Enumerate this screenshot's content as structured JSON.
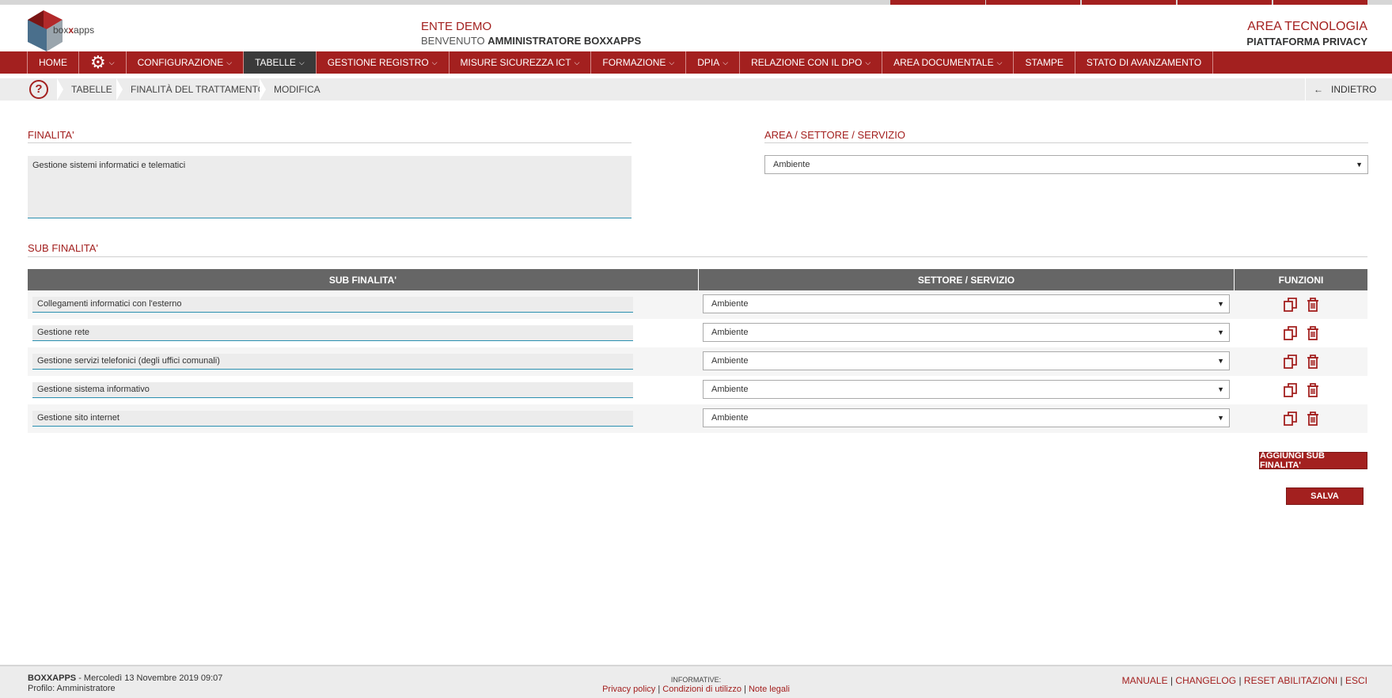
{
  "header": {
    "logo_text_pre": "box",
    "logo_text_bold": "x",
    "logo_text_post": "apps",
    "ente": "ENTE DEMO",
    "welcome_prefix": "BENVENUTO",
    "welcome_user": "AMMINISTRATORE BOXXAPPS",
    "area": "AREA TECNOLOGIA",
    "platform": "PIATTAFORMA PRIVACY"
  },
  "nav": {
    "items": [
      {
        "label": "HOME",
        "chevron": false
      },
      {
        "label": "",
        "chevron": true,
        "icon": "gear-icon"
      },
      {
        "label": "CONFIGURAZIONE",
        "chevron": true
      },
      {
        "label": "TABELLE",
        "chevron": true,
        "active": true
      },
      {
        "label": "GESTIONE REGISTRO",
        "chevron": true
      },
      {
        "label": "MISURE SICUREZZA ICT",
        "chevron": true
      },
      {
        "label": "FORMAZIONE",
        "chevron": true
      },
      {
        "label": "DPIA",
        "chevron": true
      },
      {
        "label": "RELAZIONE CON IL DPO",
        "chevron": true
      },
      {
        "label": "AREA DOCUMENTALE",
        "chevron": true
      },
      {
        "label": "STAMPE",
        "chevron": false
      },
      {
        "label": "STATO DI AVANZAMENTO",
        "chevron": false
      }
    ]
  },
  "breadcrumb": {
    "items": [
      "TABELLE",
      "FINALITÀ DEL TRATTAMENTO",
      "MODIFICA"
    ],
    "back_label": "INDIETRO"
  },
  "form": {
    "finalita_title": "FINALITA'",
    "finalita_value": "Gestione sistemi informatici e telematici",
    "area_title": "AREA / SETTORE / SERVIZIO",
    "area_value": "Ambiente",
    "sub_title": "SUB FINALITA'"
  },
  "table": {
    "headers": [
      "SUB FINALITA'",
      "SETTORE / SERVIZIO",
      "FUNZIONI"
    ],
    "rows": [
      {
        "sub": "Collegamenti informatici con l'esterno",
        "settore": "Ambiente"
      },
      {
        "sub": "Gestione rete",
        "settore": "Ambiente"
      },
      {
        "sub": "Gestione servizi telefonici (degli uffici comunali)",
        "settore": "Ambiente"
      },
      {
        "sub": "Gestione sistema informativo",
        "settore": "Ambiente"
      },
      {
        "sub": "Gestione sito internet",
        "settore": "Ambiente"
      }
    ]
  },
  "buttons": {
    "add_sub": "AGGIUNGI SUB FINALITA'",
    "save": "SALVA"
  },
  "footer": {
    "brand": "BOXXAPPS",
    "datetime": " - Mercoledì 13 Novembre 2019 09:07",
    "profile": "Profilo: Amministratore",
    "informative_label": "INFORMATIVE:",
    "links_center": [
      "Privacy policy",
      "Condizioni di utilizzo",
      "Note legali"
    ],
    "links_right": [
      "MANUALE",
      "CHANGELOG",
      "RESET ABILITAZIONI",
      "ESCI"
    ]
  },
  "colors": {
    "brand_red": "#a3201f",
    "nav_active": "#3a3a3a",
    "table_header": "#666666",
    "input_underline": "#2a8fb0"
  }
}
